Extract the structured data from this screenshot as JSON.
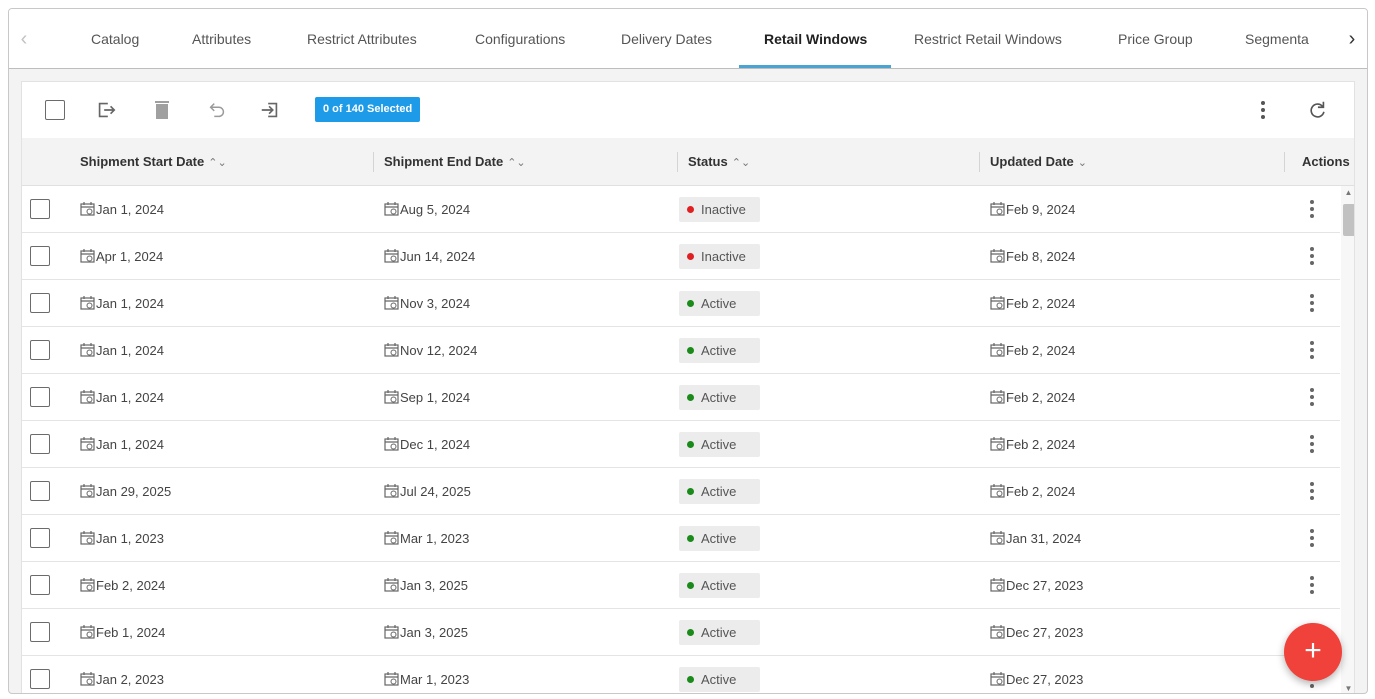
{
  "tabs": {
    "items": [
      "Catalog",
      "Attributes",
      "Restrict Attributes",
      "Configurations",
      "Delivery Dates",
      "Retail Windows",
      "Restrict Retail Windows",
      "Price Group",
      "Segmenta"
    ],
    "active": "Retail Windows",
    "accent_color": "#4aa3d1"
  },
  "toolbar": {
    "selection_badge": "0 of 140 Selected",
    "badge_color": "#1e9be8",
    "icons": [
      "checkbox",
      "export-icon",
      "delete-icon",
      "undo-icon",
      "import-icon",
      "more-vert-icon",
      "refresh-icon"
    ]
  },
  "table": {
    "columns": [
      {
        "label": "Shipment Start Date",
        "sort": "⌃⌄"
      },
      {
        "label": "Shipment End Date",
        "sort": "⌃⌄"
      },
      {
        "label": "Status",
        "sort": "⌃⌄"
      },
      {
        "label": "Updated Date",
        "sort": "⌄"
      },
      {
        "label": "Actions",
        "sort": ""
      }
    ],
    "rows": [
      {
        "start": "Jan 1, 2024",
        "end": "Aug 5, 2024",
        "status": "Inactive",
        "updated": "Feb 9, 2024"
      },
      {
        "start": "Apr 1, 2024",
        "end": "Jun 14, 2024",
        "status": "Inactive",
        "updated": "Feb 8, 2024"
      },
      {
        "start": "Jan 1, 2024",
        "end": "Nov 3, 2024",
        "status": "Active",
        "updated": "Feb 2, 2024"
      },
      {
        "start": "Jan 1, 2024",
        "end": "Nov 12, 2024",
        "status": "Active",
        "updated": "Feb 2, 2024"
      },
      {
        "start": "Jan 1, 2024",
        "end": "Sep 1, 2024",
        "status": "Active",
        "updated": "Feb 2, 2024"
      },
      {
        "start": "Jan 1, 2024",
        "end": "Dec 1, 2024",
        "status": "Active",
        "updated": "Feb 2, 2024"
      },
      {
        "start": "Jan 29, 2025",
        "end": "Jul 24, 2025",
        "status": "Active",
        "updated": "Feb 2, 2024"
      },
      {
        "start": "Jan 1, 2023",
        "end": "Mar 1, 2023",
        "status": "Active",
        "updated": "Jan 31, 2024"
      },
      {
        "start": "Feb 2, 2024",
        "end": "Jan 3, 2025",
        "status": "Active",
        "updated": "Dec 27, 2023"
      },
      {
        "start": "Feb 1, 2024",
        "end": "Jan 3, 2025",
        "status": "Active",
        "updated": "Dec 27, 2023"
      },
      {
        "start": "Jan 2, 2023",
        "end": "Mar 1, 2023",
        "status": "Active",
        "updated": "Dec 27, 2023"
      }
    ]
  },
  "status_colors": {
    "Active": "#1a8a1a",
    "Inactive": "#e02020"
  },
  "fab": {
    "label": "+",
    "color": "#f0413a"
  }
}
